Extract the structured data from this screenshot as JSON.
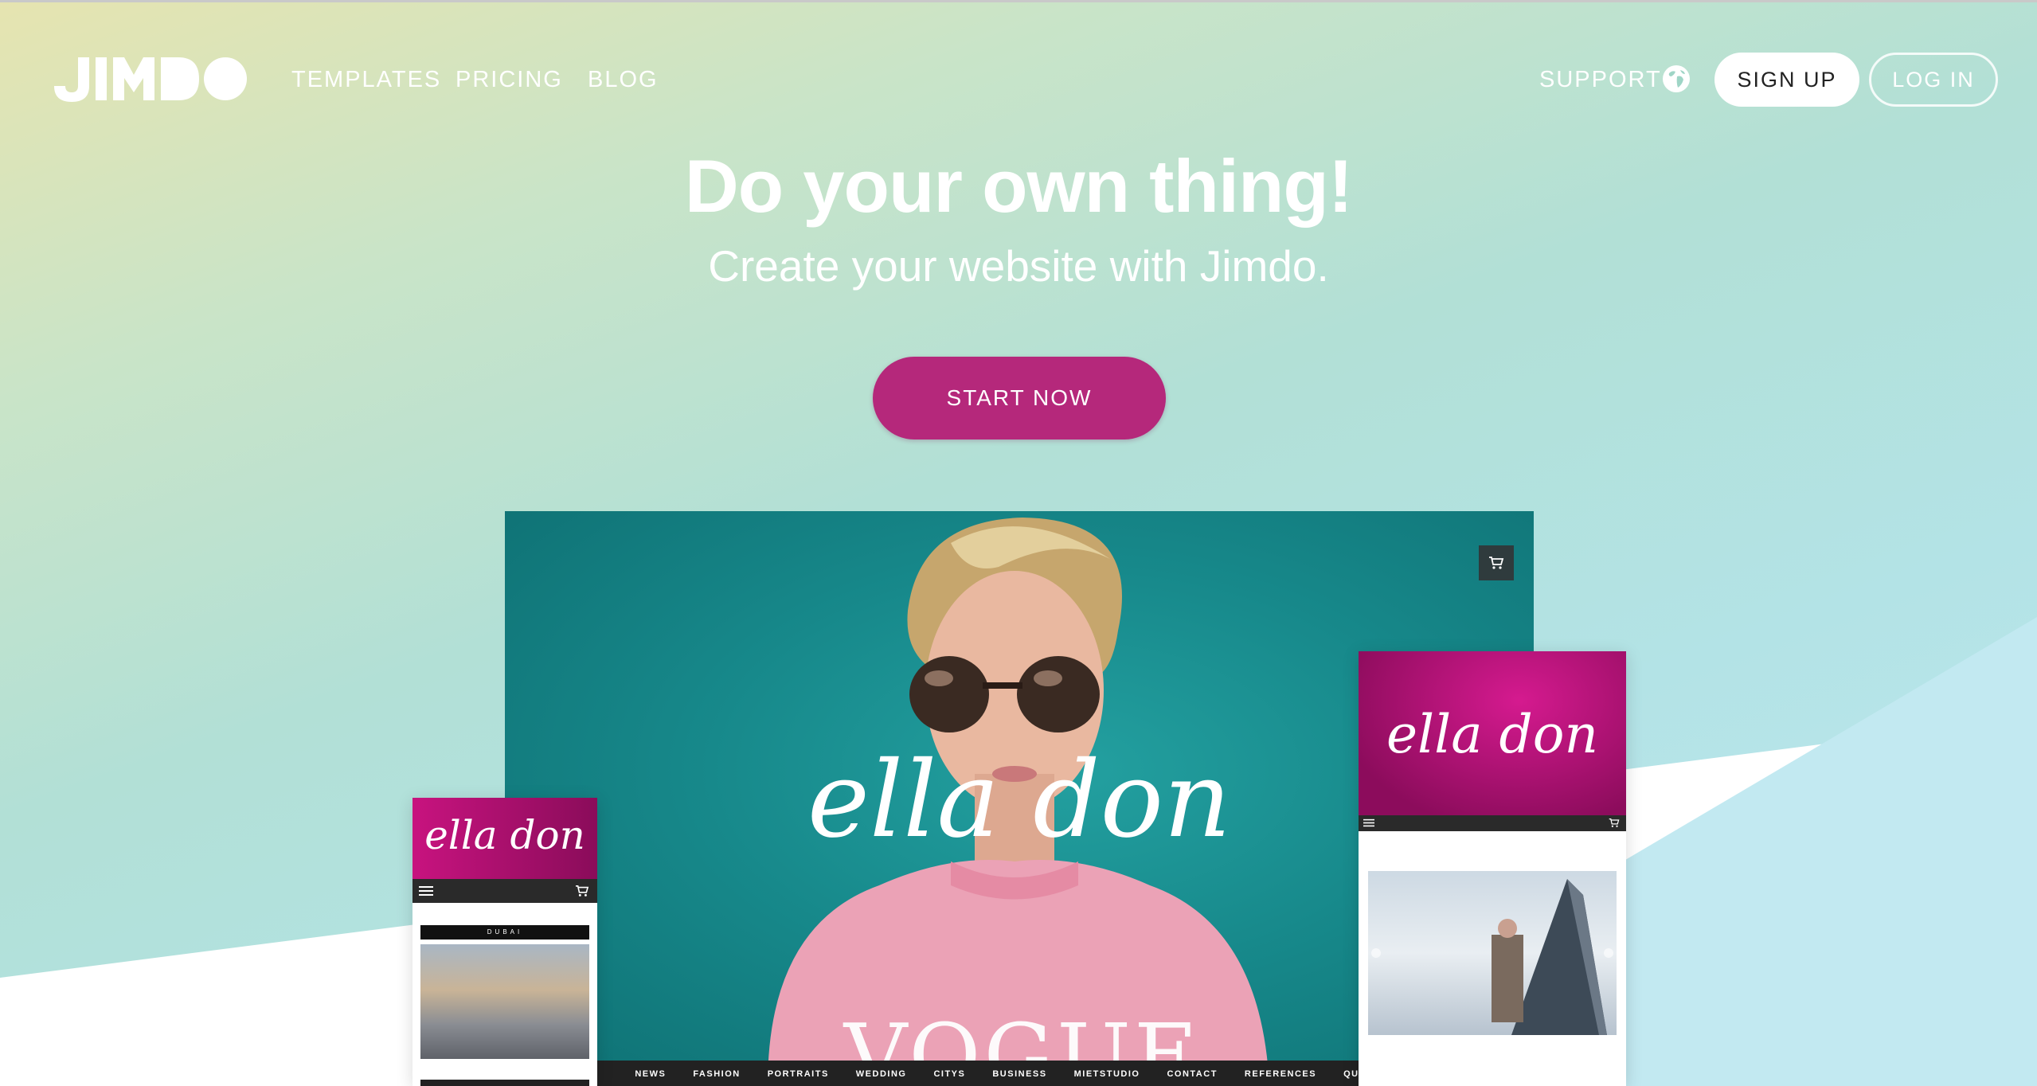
{
  "brand": {
    "name": "JIMDO"
  },
  "nav": {
    "templates": "TEMPLATES",
    "pricing": "PRICING",
    "blog": "BLOG",
    "support": "SUPPORT",
    "signup": "SIGN UP",
    "login": "LOG IN"
  },
  "hero": {
    "title": "Do your own thing!",
    "subtitle": "Create your website with Jimdo.",
    "cta": "START NOW"
  },
  "mockup": {
    "script_title": "ella don",
    "sweater_text": "VOGUE",
    "menu": [
      "NEWS",
      "FASHION",
      "PORTRAITS",
      "WEDDING",
      "CITYS",
      "BUSINESS",
      "MIETSTUDIO",
      "CONTACT",
      "REFERENCES",
      "QUEENDON"
    ],
    "phone_label": "DUBAI"
  },
  "colors": {
    "accent": "#b5287b",
    "brand_magenta": "#c8137f",
    "teal": "#17898b"
  },
  "icons": [
    "globe-icon",
    "cart-icon",
    "hamburger-icon"
  ]
}
